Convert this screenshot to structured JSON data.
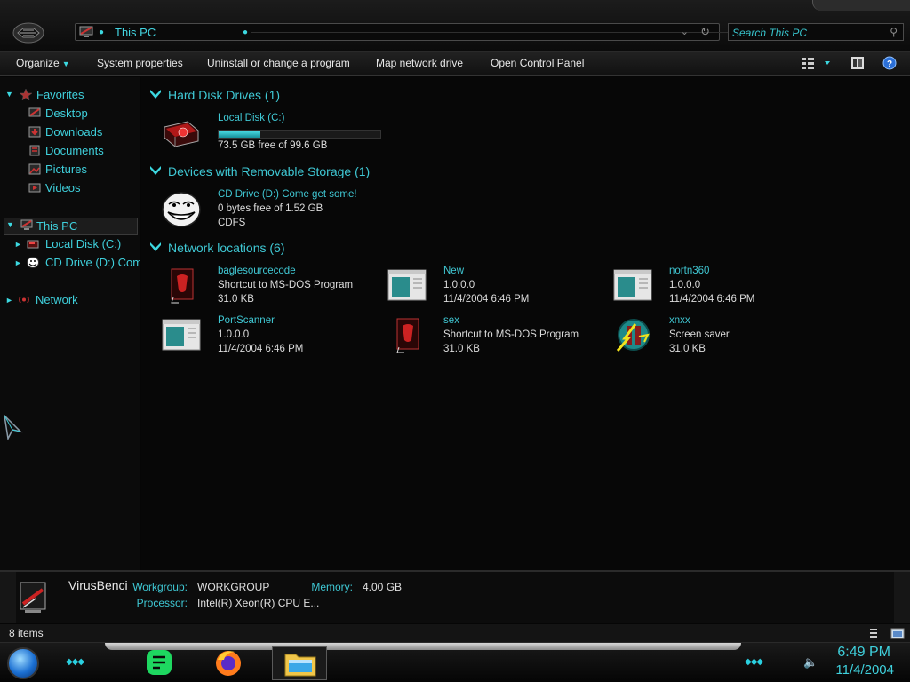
{
  "address": {
    "location": "This PC"
  },
  "search": {
    "placeholder": "Search This PC"
  },
  "toolbar": {
    "organize": "Organize",
    "system_properties": "System properties",
    "uninstall": "Uninstall or change a program",
    "map_drive": "Map network drive",
    "control_panel": "Open Control Panel"
  },
  "nav": {
    "favorites": "Favorites",
    "favorite_items": [
      "Desktop",
      "Downloads",
      "Documents",
      "Pictures",
      "Videos"
    ],
    "this_pc": "This PC",
    "pc_items": [
      "Local Disk (C:)",
      "CD Drive (D:) Come get some!"
    ],
    "network": "Network"
  },
  "groups": {
    "hard_disks": {
      "header": "Hard Disk Drives (1)",
      "items": [
        {
          "name": "Local Disk (C:)",
          "free": "73.5 GB free of 99.6 GB",
          "used_fraction": 0.26
        }
      ]
    },
    "removable": {
      "header": "Devices with Removable Storage (1)",
      "items": [
        {
          "name": "CD Drive (D:) Come get some!",
          "free": "0 bytes free of 1.52 GB",
          "fs": "CDFS"
        }
      ]
    },
    "network": {
      "header": "Network locations (6)",
      "items": [
        {
          "name": "baglesourcecode",
          "line2": "Shortcut to MS-DOS Program",
          "line3": "31.0 KB",
          "icon": "msdos-shortcut-icon"
        },
        {
          "name": "New",
          "line2": "1.0.0.0",
          "line3": "11/4/2004 6:46 PM",
          "icon": "window-file-icon"
        },
        {
          "name": "nortn360",
          "line2": "1.0.0.0",
          "line3": "11/4/2004 6:46 PM",
          "icon": "window-file-icon"
        },
        {
          "name": "PortScanner",
          "line2": "1.0.0.0",
          "line3": "11/4/2004 6:46 PM",
          "icon": "window-file-icon"
        },
        {
          "name": "sex",
          "line2": "Shortcut to MS-DOS Program",
          "line3": "31.0 KB",
          "icon": "msdos-shortcut-icon"
        },
        {
          "name": "xnxx",
          "line2": "Screen saver",
          "line3": "31.0 KB",
          "icon": "screen-saver-icon"
        }
      ]
    }
  },
  "details": {
    "computer_name": "VirusBenci",
    "workgroup_label": "Workgroup:",
    "workgroup": "WORKGROUP",
    "memory_label": "Memory:",
    "memory": "4.00 GB",
    "processor_label": "Processor:",
    "processor": "Intel(R) Xeon(R) CPU E..."
  },
  "status": {
    "items_count": "8 items"
  },
  "clock": {
    "time": "6:49 PM",
    "date": "11/4/2004"
  },
  "colors": {
    "accent": "#3fd0dc",
    "background": "#070707",
    "progress": "#2bb8c4"
  }
}
